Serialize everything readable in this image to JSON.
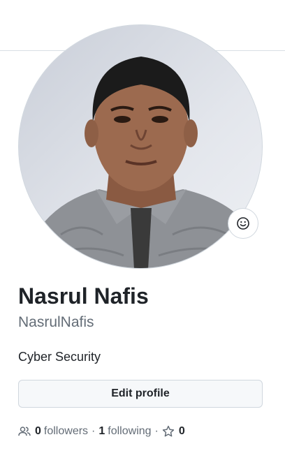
{
  "profile": {
    "name": "Nasrul Nafis",
    "username": "NasrulNafis",
    "bio": "Cyber Security",
    "edit_label": "Edit profile",
    "followers_count": "0",
    "followers_label": "followers",
    "following_count": "1",
    "following_label": "following",
    "separator": "·",
    "stars_count": "0"
  },
  "icons": {
    "status": "smiley-icon",
    "people": "people-icon",
    "star": "star-icon"
  },
  "colors": {
    "text": "#1f2328",
    "muted": "#636c76",
    "border": "#d0d7de",
    "button_bg": "#f6f8fa"
  }
}
